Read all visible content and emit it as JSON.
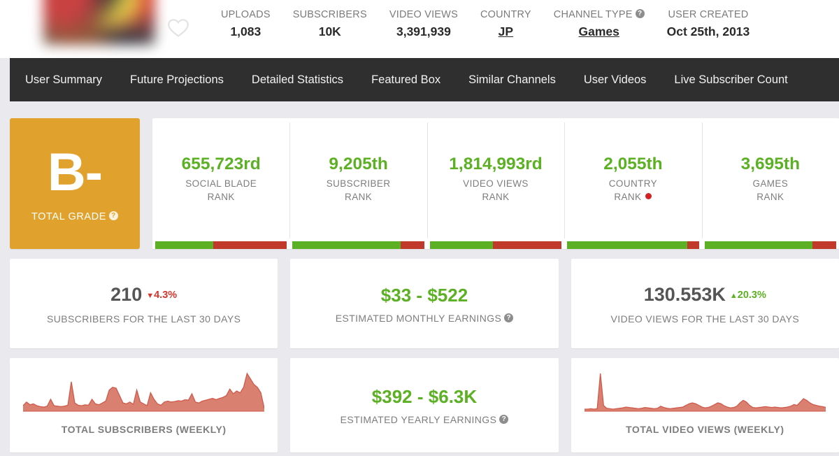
{
  "header": {
    "favorite_icon": "heart-icon",
    "stats": [
      {
        "label": "UPLOADS",
        "value": "1,083",
        "link": false,
        "help": false
      },
      {
        "label": "SUBSCRIBERS",
        "value": "10K",
        "link": false,
        "help": false
      },
      {
        "label": "VIDEO VIEWS",
        "value": "3,391,939",
        "link": false,
        "help": false
      },
      {
        "label": "COUNTRY",
        "value": "JP",
        "link": true,
        "help": false
      },
      {
        "label": "CHANNEL TYPE",
        "value": "Games",
        "link": true,
        "help": true
      },
      {
        "label": "USER CREATED",
        "value": "Oct 25th, 2013",
        "link": false,
        "help": false
      }
    ]
  },
  "nav": {
    "items": [
      {
        "label": "User Summary"
      },
      {
        "label": "Future Projections"
      },
      {
        "label": "Detailed Statistics"
      },
      {
        "label": "Featured Box"
      },
      {
        "label": "Similar Channels"
      },
      {
        "label": "User Videos"
      },
      {
        "label": "Live Subscriber Count"
      }
    ]
  },
  "grade": {
    "letter": "B-",
    "caption": "TOTAL GRADE",
    "color": "#e0a22c",
    "help": true
  },
  "ranks": [
    {
      "value": "655,723rd",
      "label_line1": "SOCIAL BLADE",
      "label_line2": "RANK",
      "bar_green_pct": 44,
      "dot": false
    },
    {
      "value": "9,205th",
      "label_line1": "SUBSCRIBER",
      "label_line2": "RANK",
      "bar_green_pct": 82,
      "dot": false
    },
    {
      "value": "1,814,993rd",
      "label_line1": "VIDEO VIEWS",
      "label_line2": "RANK",
      "bar_green_pct": 48,
      "dot": false
    },
    {
      "value": "2,055th",
      "label_line1": "COUNTRY",
      "label_line2": "RANK",
      "bar_green_pct": 91,
      "dot": true
    },
    {
      "value": "3,695th",
      "label_line1": "GAMES",
      "label_line2": "RANK",
      "bar_green_pct": 82,
      "dot": false
    }
  ],
  "summary_cards": {
    "subscribers_30d": {
      "value": "210",
      "delta": "4.3%",
      "delta_direction": "down",
      "delta_color": "#d9342b",
      "caption": "SUBSCRIBERS FOR THE LAST 30 DAYS"
    },
    "monthly_earnings": {
      "low": "$33",
      "separator": "-",
      "high": "$522",
      "caption": "ESTIMATED MONTHLY EARNINGS",
      "color": "#5cb023",
      "help": true
    },
    "video_views_30d": {
      "value": "130.553K",
      "delta": "20.3%",
      "delta_direction": "up",
      "delta_color": "#5cb023",
      "caption": "VIDEO VIEWS FOR THE LAST 30 DAYS"
    },
    "yearly_earnings": {
      "low": "$392",
      "separator": "-",
      "high": "$6.3K",
      "caption": "ESTIMATED YEARLY EARNINGS",
      "color": "#5cb023",
      "help": true
    }
  },
  "chart_data": [
    {
      "type": "area",
      "name": "total-subscribers-weekly",
      "title": "TOTAL SUBSCRIBERS (WEEKLY)",
      "color": "#cf5a4a",
      "fill": "#d46a58",
      "grid": false,
      "xlabel": "",
      "ylabel": "",
      "ylim": [
        0,
        100
      ],
      "values": [
        12,
        20,
        14,
        16,
        12,
        10,
        9,
        11,
        26,
        12,
        11,
        10,
        11,
        13,
        64,
        18,
        13,
        12,
        14,
        13,
        26,
        16,
        14,
        18,
        22,
        46,
        52,
        50,
        34,
        18,
        16,
        20,
        15,
        46,
        20,
        16,
        12,
        40,
        26,
        16,
        13,
        20,
        22,
        20,
        21,
        23,
        22,
        25,
        24,
        38,
        20,
        18,
        22,
        24,
        26,
        28,
        25,
        28,
        30,
        34,
        48,
        38,
        44,
        40,
        52,
        82,
        70,
        58,
        52,
        40,
        6
      ]
    },
    {
      "type": "area",
      "name": "total-video-views-weekly",
      "title": "TOTAL VIDEO VIEWS (WEEKLY)",
      "color": "#cf5a4a",
      "fill": "#d46a58",
      "grid": false,
      "xlabel": "",
      "ylabel": "",
      "ylim": [
        0,
        100
      ],
      "values": [
        5,
        5,
        6,
        5,
        6,
        90,
        14,
        7,
        6,
        5,
        6,
        7,
        8,
        10,
        9,
        8,
        7,
        6,
        7,
        9,
        8,
        7,
        6,
        7,
        12,
        9,
        7,
        6,
        7,
        8,
        9,
        10,
        14,
        18,
        20,
        18,
        14,
        10,
        8,
        9,
        12,
        16,
        20,
        18,
        13,
        10,
        8,
        9,
        12,
        20,
        26,
        22,
        14,
        9,
        8,
        9,
        10,
        11,
        10,
        9,
        10,
        9,
        8,
        9,
        10,
        12,
        16,
        14,
        22,
        30,
        26,
        20,
        16,
        14,
        12,
        11,
        9
      ]
    }
  ]
}
